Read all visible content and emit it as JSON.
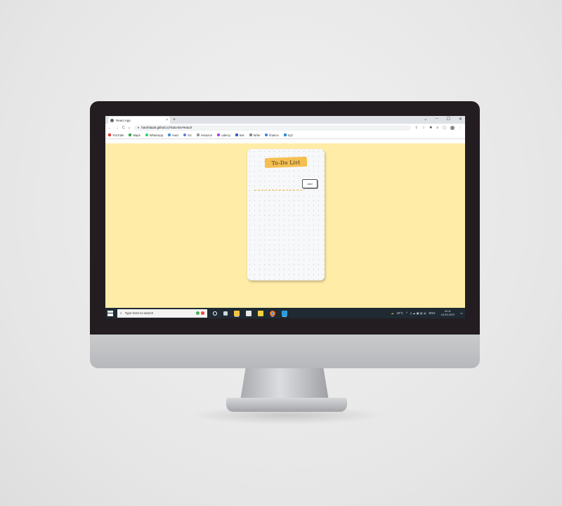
{
  "browser": {
    "tab_title": "React App",
    "tab_close": "×",
    "new_tab": "+",
    "window_controls": [
      "⌄",
      "–",
      "☐",
      "✕"
    ],
    "nav": {
      "back": "←",
      "forward": "→",
      "reload": "C",
      "home": "⌂"
    },
    "url": "harshita26.github.io/Todo-list-React/",
    "addr_icons": [
      "⇪",
      "☆",
      "✱",
      "≡",
      "▢"
    ],
    "avatar_letter": "",
    "menu": "⋮"
  },
  "bookmarks": [
    {
      "label": "YouTube",
      "color": "#e53935"
    },
    {
      "label": "Maps",
      "color": "#34a853"
    },
    {
      "label": "WhatsApp",
      "color": "#25d366"
    },
    {
      "label": "react",
      "color": "#4a90d9"
    },
    {
      "label": "src",
      "color": "#5b7bd5"
    },
    {
      "label": "resource",
      "color": "#999999"
    },
    {
      "label": "udemy",
      "color": "#a435f0"
    },
    {
      "label": "test",
      "color": "#3a56c5"
    },
    {
      "label": "Write",
      "color": "#888888"
    },
    {
      "label": "finance",
      "color": "#3f7bd8"
    },
    {
      "label": "try2",
      "color": "#2a8dd4"
    }
  ],
  "app": {
    "title": "To-Do List",
    "input_placeholder": "",
    "add_label": "Add",
    "page_bg": "#ffeca7",
    "title_bg": "#f5bf50"
  },
  "taskbar": {
    "search_placeholder": "Type here to search",
    "weather": "20°C",
    "language": "ENG",
    "time": "20:11",
    "date": "18-03-2022"
  }
}
